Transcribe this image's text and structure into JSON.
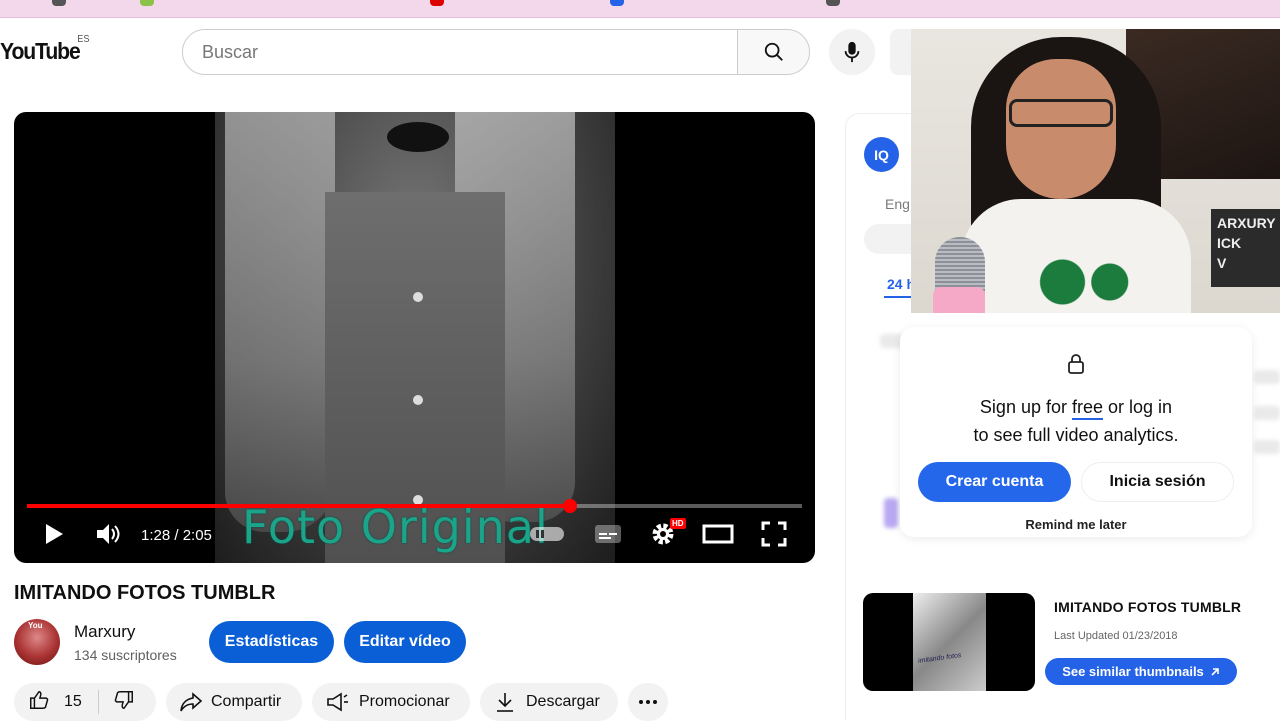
{
  "header": {
    "logo_text": "YouTube",
    "logo_lang": "ES",
    "search_placeholder": "Buscar"
  },
  "player": {
    "overlay_text": "Foto Original",
    "time": "1:28 / 2:05",
    "hd_label": "HD",
    "progress_fraction": 0.7
  },
  "video": {
    "title": "IMITANDO FOTOS TUMBLR",
    "channel_name": "Marxury",
    "channel_subs": "134 suscriptores",
    "stats_button": "Estadísticas",
    "edit_button": "Editar vídeo",
    "likes": "15",
    "share": "Compartir",
    "promote": "Promocionar",
    "download": "Descargar"
  },
  "side": {
    "logo_text": "IQ",
    "lang_text": "Eng",
    "tab_text": "24 h",
    "modal": {
      "line1_pre": "Sign up for ",
      "line1_free": "free",
      "line1_post": " or log in",
      "line2": "to see full video analytics.",
      "create": "Crear cuenta",
      "login": "Inicia sesión",
      "remind": "Remind me later"
    },
    "related": {
      "title": "IMITANDO FOTOS TUMBLR",
      "updated": "Last Updated 01/23/2018",
      "button": "See similar thumbnails",
      "thumb_caption": "imitando fotos"
    }
  },
  "webcam": {
    "sign_lines": [
      "ARXURY",
      "ICK",
      "V"
    ]
  },
  "colors": {
    "brand_blue": "#0b5fd6",
    "extension_blue": "#2462e8",
    "progress_red": "#ff0000",
    "overlay_teal": "#1aa58a"
  }
}
